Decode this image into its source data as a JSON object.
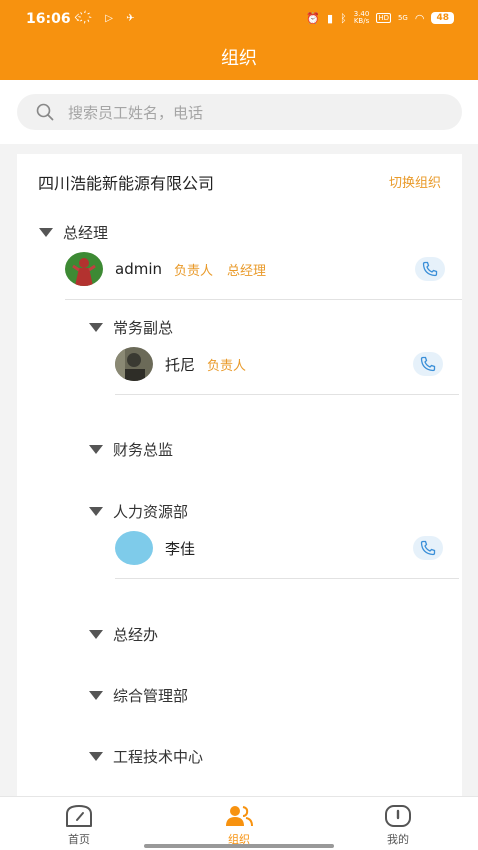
{
  "status_bar": {
    "time": "16:06",
    "left_icons": "☇ ҉ ▷ ✈",
    "network_speed": "3.40\nKB/s",
    "hd": "HD",
    "signal": "5G",
    "battery": "48"
  },
  "header": {
    "title": "组织"
  },
  "search": {
    "placeholder": "搜索员工姓名，电话"
  },
  "org": {
    "company_name": "四川浩能新能源有限公司",
    "switch_label": "切换组织",
    "departments": [
      {
        "label": "总经理",
        "members": [
          {
            "name": "admin",
            "tags": [
              "负责人",
              "总经理"
            ],
            "avatar_color": "#2f7d2a"
          }
        ]
      },
      {
        "label": "常务副总",
        "members": [
          {
            "name": "托尼",
            "tags": [
              "负责人"
            ],
            "avatar_color": "#5b5a4c"
          }
        ]
      },
      {
        "label": "财务总监",
        "members": []
      },
      {
        "label": "人力资源部",
        "members": [
          {
            "name": "李佳",
            "tags": [],
            "avatar_color": "#7ecbea"
          }
        ]
      },
      {
        "label": "总经办",
        "members": []
      },
      {
        "label": "综合管理部",
        "members": []
      },
      {
        "label": "工程技术中心",
        "members": []
      }
    ]
  },
  "tabbar": {
    "tabs": [
      {
        "label": "首页",
        "icon": "home-dial-icon",
        "active": false
      },
      {
        "label": "组织",
        "icon": "people-icon",
        "active": true
      },
      {
        "label": "我的",
        "icon": "profile-icon",
        "active": false
      }
    ]
  },
  "colors": {
    "brand": "#f7920f",
    "tag": "#e99a2a",
    "phone_bg": "#e6f1fa",
    "phone_icon": "#3a8fd8"
  }
}
